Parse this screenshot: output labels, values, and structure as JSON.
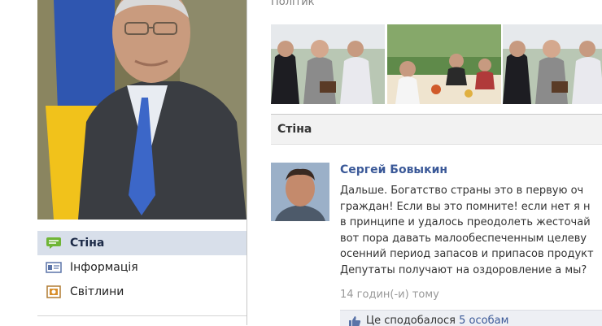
{
  "profile": {
    "nav": [
      {
        "label": "Стіна",
        "icon": "wall-icon",
        "active": true
      },
      {
        "label": "Інформація",
        "icon": "info-icon",
        "active": false
      },
      {
        "label": "Світлини",
        "icon": "photos-icon",
        "active": false
      }
    ]
  },
  "main": {
    "section_label": "Політик",
    "wall_title": "Стіна",
    "post": {
      "author": "Сергей Бовыкин",
      "lines": [
        "Дальше. Богатство страны это в первую оч",
        "граждан! Если вы это помните! если нет я н",
        "в принципе и удалось преодолеть жесточай",
        "вот пора давать малообеспеченным целеву",
        "осенний период запасов и припасов продукт",
        "Депутаты получают на оздоровление а мы?"
      ],
      "time": "14 годин(-и) тому",
      "likes_prefix": "Це сподобалося",
      "likes_link": "5 особам"
    }
  },
  "colors": {
    "link": "#3b5998",
    "nav_active_bg": "#d8dfea",
    "wall_header_bg": "#f2f2f2",
    "like_bar_bg": "#edeff4"
  }
}
